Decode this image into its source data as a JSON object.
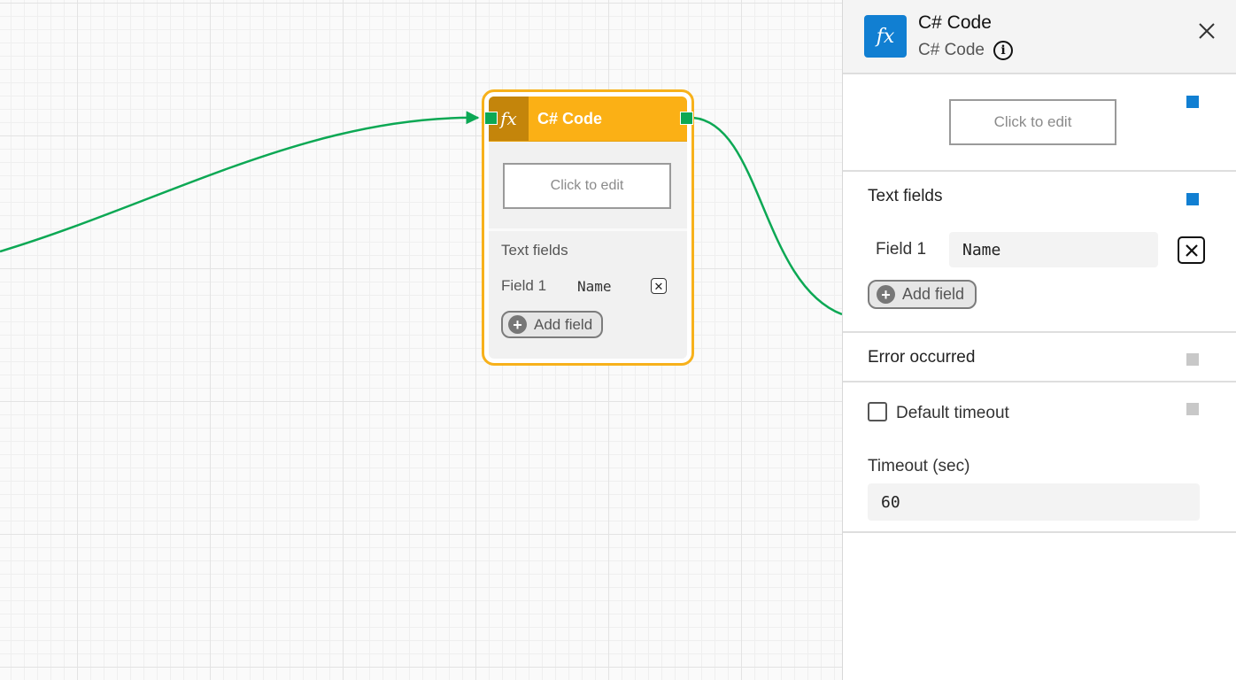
{
  "canvas": {
    "node": {
      "icon": "fx-icon",
      "title": "C# Code",
      "edit_placeholder": "Click to edit",
      "section_title": "Text fields",
      "fields": [
        {
          "label": "Field 1",
          "value": "Name"
        }
      ],
      "add_field_label": "Add field"
    }
  },
  "panel": {
    "icon": "fx-icon",
    "title": "C# Code",
    "subtitle": "C# Code",
    "edit_placeholder": "Click to edit",
    "text_fields": {
      "title": "Text fields",
      "fields": [
        {
          "label": "Field 1",
          "value": "Name"
        }
      ],
      "add_field_label": "Add field"
    },
    "error_section": {
      "title": "Error occurred"
    },
    "timeout": {
      "checkbox_label": "Default timeout",
      "checked": false,
      "timeout_label": "Timeout (sec)",
      "timeout_value": "60"
    }
  },
  "colors": {
    "node_accent": "#fbb015",
    "node_border": "#f7b11b",
    "connector": "#0ca854",
    "panel_brand": "#117fd2",
    "port_inactive": "#c8c8c8"
  }
}
